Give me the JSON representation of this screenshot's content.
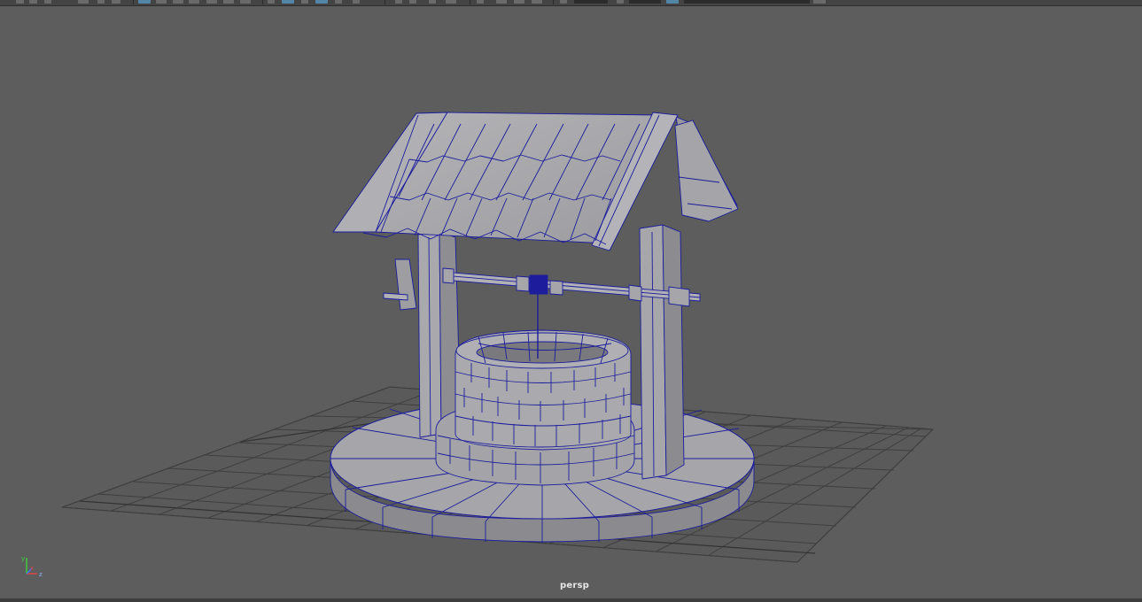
{
  "viewport": {
    "camera_name": "persp",
    "background_color": "#5d5d5d",
    "grid_color": "#3e3e3e",
    "wire_color": "#1c1c9c",
    "mesh_fill_color": "#a3a3a6",
    "scene_object": "wishing-well-model",
    "display_mode": "shaded-with-wireframe"
  },
  "axis_gizmo": {
    "x_color": "#e34545",
    "y_color": "#3ed13e",
    "z_color": "#3f7bff",
    "x_label": "x",
    "y_label": "y",
    "z_label": "z"
  },
  "toolbar": {
    "icons": [
      "undo-icon",
      "redo-icon",
      "select-tool-icon",
      "lasso-tool-icon",
      "layout-icon",
      "layout-icon",
      "layout-icon",
      "render-icon",
      "ipr-icon",
      "snap-icon",
      "camera-icon",
      "magnet-icon",
      "field-icon"
    ],
    "accent_color": "#5285a6"
  }
}
